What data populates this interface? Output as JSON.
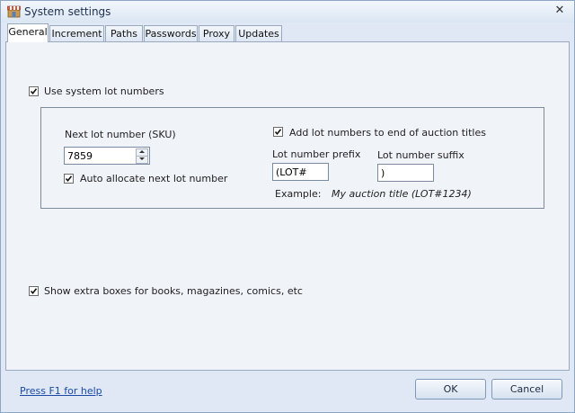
{
  "window": {
    "title": "System settings"
  },
  "tabs": [
    {
      "label": "General",
      "active": true
    },
    {
      "label": "Increment",
      "active": false
    },
    {
      "label": "Paths",
      "active": false
    },
    {
      "label": "Passwords",
      "active": false
    },
    {
      "label": "Proxy",
      "active": false
    },
    {
      "label": "Updates",
      "active": false
    }
  ],
  "general": {
    "use_system_lot": {
      "label": "Use system lot numbers",
      "checked": true
    },
    "next_lot": {
      "label": "Next lot number (SKU)",
      "value": "7859"
    },
    "auto_allocate": {
      "label": "Auto allocate next lot number",
      "checked": true
    },
    "add_to_titles": {
      "label": "Add lot numbers to end of auction titles",
      "checked": true
    },
    "prefix": {
      "label": "Lot number prefix",
      "value": "(LOT#"
    },
    "suffix": {
      "label": "Lot number suffix",
      "value": ")"
    },
    "example": {
      "label": "Example:",
      "value": "My auction title (LOT#1234)"
    },
    "extra_boxes": {
      "label": "Show extra boxes for books, magazines, comics, etc",
      "checked": true
    }
  },
  "footer": {
    "help_link": "Press F1 for help",
    "ok_label": "OK",
    "cancel_label": "Cancel"
  },
  "icons": {
    "app": "store-icon",
    "close": "close-icon",
    "check": "checkmark-icon",
    "spin_up": "spin-up-icon",
    "spin_down": "spin-down-icon"
  },
  "colors": {
    "window_bg": "#dfe8f4",
    "page_bg": "#f0f3f8",
    "link": "#1a4aa6",
    "frame": "#8ea6c6"
  }
}
